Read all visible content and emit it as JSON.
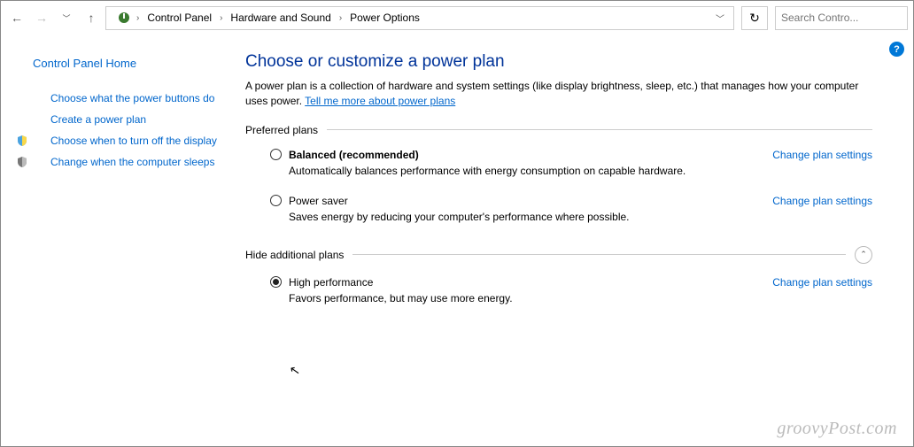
{
  "breadcrumbs": [
    "Control Panel",
    "Hardware and Sound",
    "Power Options"
  ],
  "search": {
    "placeholder": "Search Contro..."
  },
  "sidebar": {
    "home": "Control Panel Home",
    "items": [
      "Choose what the power buttons do",
      "Create a power plan",
      "Choose when to turn off the display",
      "Change when the computer sleeps"
    ]
  },
  "main": {
    "title": "Choose or customize a power plan",
    "desc_prefix": "A power plan is a collection of hardware and system settings (like display brightness, sleep, etc.) that manages how your computer uses power. ",
    "desc_link": "Tell me more about power plans",
    "preferred_label": "Preferred plans",
    "additional_label": "Hide additional plans",
    "change_link": "Change plan settings",
    "plans_preferred": [
      {
        "name": "Balanced (recommended)",
        "sub": "Automatically balances performance with energy consumption on capable hardware.",
        "bold": true,
        "selected": false
      },
      {
        "name": "Power saver",
        "sub": "Saves energy by reducing your computer's performance where possible.",
        "bold": false,
        "selected": false
      }
    ],
    "plans_additional": [
      {
        "name": "High performance",
        "sub": "Favors performance, but may use more energy.",
        "bold": false,
        "selected": true
      }
    ]
  },
  "watermark": "groovyPost.com"
}
